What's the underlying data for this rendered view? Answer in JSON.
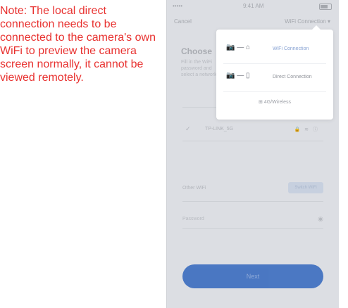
{
  "note": {
    "text": "Note: The local direct connection needs to be connected to the camera's own WiFi to preview the camera screen normally, it cannot be viewed remotely."
  },
  "phone": {
    "statusbar": {
      "signal": "••••• ",
      "time": "9:41 AM"
    },
    "navbar": {
      "cancel": "Cancel",
      "mode": "WiFi Connection ▾"
    },
    "title": "Choose",
    "description": "Fill in the WiFi password and select a network",
    "wifi_row": {
      "check": "✓",
      "ssid": "TP-LINK_5G",
      "icons": "🔒 ≋ ⓘ"
    },
    "other_row": {
      "label": "Other WiFi",
      "button": "Switch WiFi"
    },
    "input_row": {
      "placeholder": "Password",
      "eye": "◉"
    },
    "next_button": "Next",
    "dropdown": {
      "items": [
        {
          "icon": "📷 — ⌂",
          "label": "WiFi Connection"
        },
        {
          "icon": "📷 — ▯",
          "label": "Direct Connection"
        }
      ],
      "wireless": "⊞  4G/Wireless"
    }
  }
}
